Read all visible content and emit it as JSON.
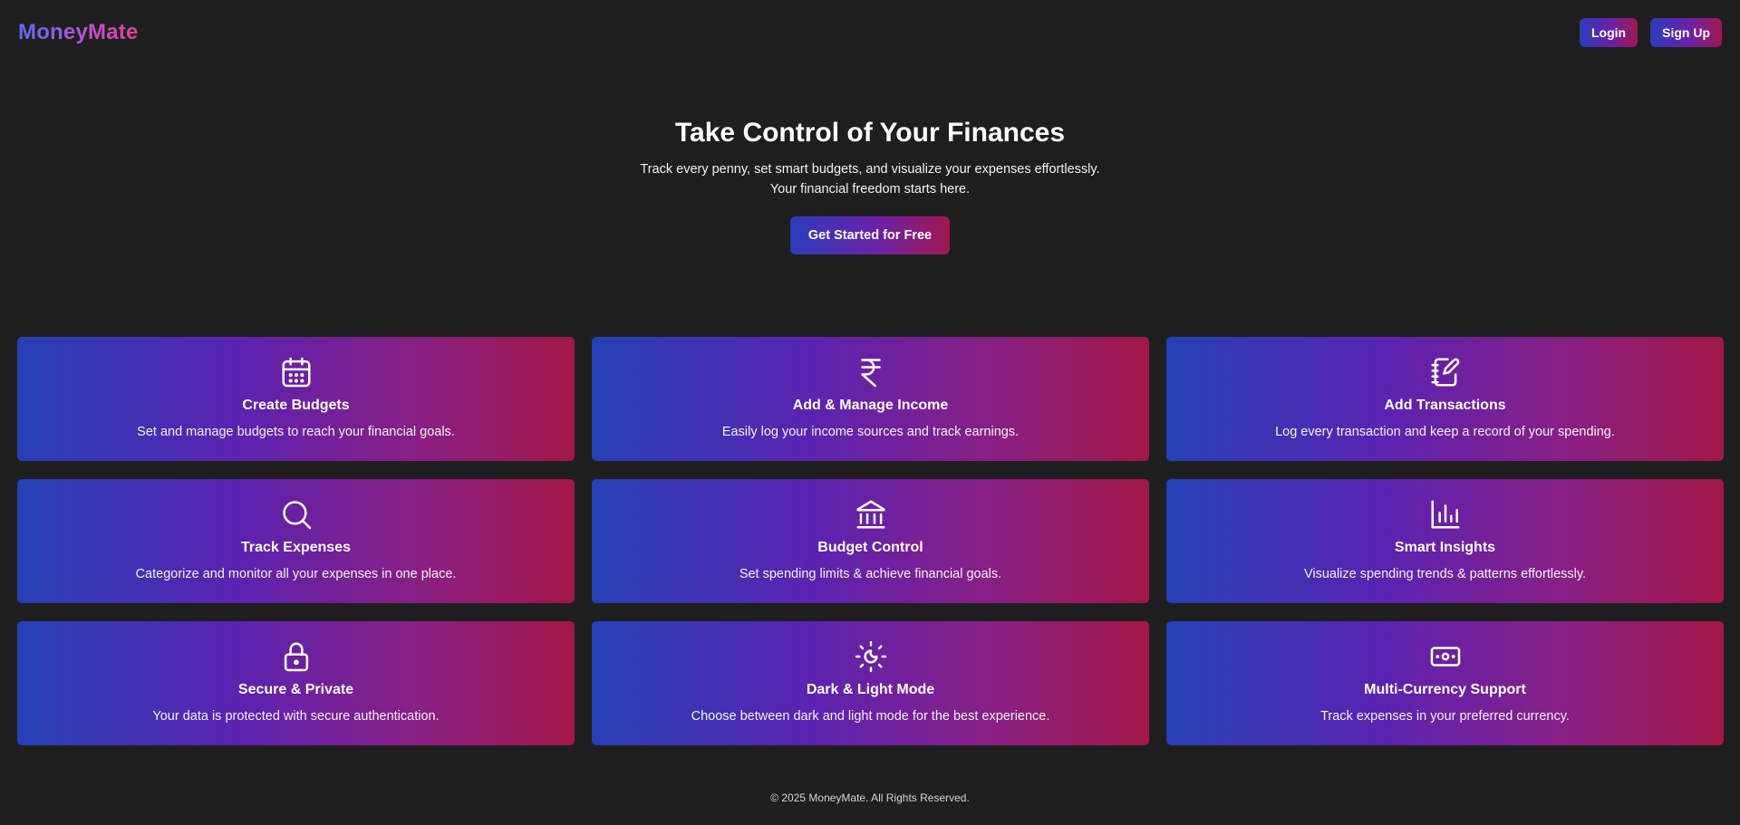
{
  "brand": {
    "name": "MoneyMate"
  },
  "nav": {
    "login_label": "Login",
    "signup_label": "Sign Up"
  },
  "hero": {
    "title": "Take Control of Your Finances",
    "subtitle": "Track every penny, set smart budgets, and visualize your expenses effortlessly. Your financial freedom starts here.",
    "cta_label": "Get Started for Free"
  },
  "features": [
    {
      "icon": "calendar-icon",
      "title": "Create Budgets",
      "desc": "Set and manage budgets to reach your financial goals."
    },
    {
      "icon": "rupee-icon",
      "title": "Add & Manage Income",
      "desc": "Easily log your income sources and track earnings."
    },
    {
      "icon": "notebook-pen-icon",
      "title": "Add Transactions",
      "desc": "Log every transaction and keep a record of your spending."
    },
    {
      "icon": "search-icon",
      "title": "Track Expenses",
      "desc": "Categorize and monitor all your expenses in one place."
    },
    {
      "icon": "bank-icon",
      "title": "Budget Control",
      "desc": "Set spending limits & achieve financial goals."
    },
    {
      "icon": "bar-chart-icon",
      "title": "Smart Insights",
      "desc": "Visualize spending trends & patterns effortlessly."
    },
    {
      "icon": "lock-icon",
      "title": "Secure & Private",
      "desc": "Your data is protected with secure authentication."
    },
    {
      "icon": "sun-moon-icon",
      "title": "Dark & Light Mode",
      "desc": "Choose between dark and light mode for the best experience."
    },
    {
      "icon": "banknote-icon",
      "title": "Multi-Currency Support",
      "desc": "Track expenses in your preferred currency."
    }
  ],
  "footer": {
    "text": "© 2025 MoneyMate. All Rights Reserved."
  },
  "colors": {
    "background": "#1e1e1e",
    "gradient_start": "#2440b5",
    "gradient_mid": "#5b22b0",
    "gradient_end": "#a21748"
  }
}
